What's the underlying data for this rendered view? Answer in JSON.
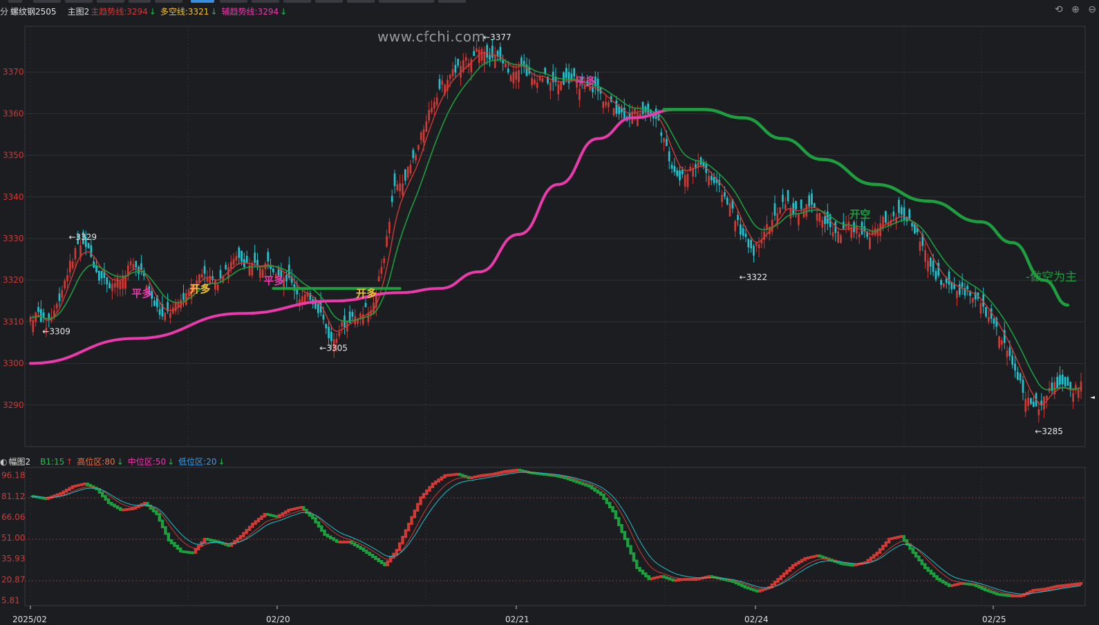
{
  "header": {
    "prefix": "分",
    "symbol": "螺纹钢2505",
    "chart_name": "主图2",
    "main_trend": "主趋势线:3294",
    "long_short": "多空线:3321",
    "aux_trend": "辅趋势线:3294",
    "arrow_down": "↓"
  },
  "subheader": {
    "prefix": "◐",
    "name": "幅图2",
    "b1": "B1:15",
    "b1_arrow": "↑",
    "high": "高位区:80",
    "mid": "中位区:50",
    "low": "低位区:20",
    "arrow_down": "↓"
  },
  "watermark": "www.cfchi.com",
  "toolbar": {
    "undo_icon": "⟲",
    "zoom_in_icon": "⊕",
    "zoom_out_icon": "⊖"
  },
  "colors": {
    "background": "#1c1d21",
    "up": "#d23a36",
    "down": "#1fc4cf",
    "main_trend": "#ea3aab",
    "long_short": "#1e9e3e",
    "red_line": "#d23a36",
    "grid": "#2e3036"
  },
  "chart_data": [
    {
      "type": "candlestick",
      "title": "螺纹钢2505",
      "y_ticks": [
        3370,
        3360,
        3350,
        3340,
        3330,
        3320,
        3310,
        3300,
        3290
      ],
      "ylim": [
        3280,
        3381
      ],
      "x_labels": [
        "2025/02",
        "02/20",
        "02/21",
        "02/24",
        "02/25"
      ],
      "anchors": [
        [
          0,
          3311
        ],
        [
          3,
          3312
        ],
        [
          6,
          3309
        ],
        [
          10,
          3314
        ],
        [
          14,
          3322
        ],
        [
          18,
          3329
        ],
        [
          22,
          3327
        ],
        [
          26,
          3321
        ],
        [
          30,
          3319
        ],
        [
          34,
          3320
        ],
        [
          38,
          3324
        ],
        [
          42,
          3322
        ],
        [
          46,
          3315
        ],
        [
          50,
          3311
        ],
        [
          54,
          3313
        ],
        [
          58,
          3316
        ],
        [
          62,
          3320
        ],
        [
          66,
          3322
        ],
        [
          70,
          3319
        ],
        [
          74,
          3323
        ],
        [
          78,
          3325
        ],
        [
          82,
          3324
        ],
        [
          86,
          3323
        ],
        [
          90,
          3324
        ],
        [
          94,
          3322
        ],
        [
          98,
          3320
        ],
        [
          102,
          3316
        ],
        [
          106,
          3316
        ],
        [
          110,
          3312
        ],
        [
          114,
          3305
        ],
        [
          118,
          3309
        ],
        [
          122,
          3311
        ],
        [
          126,
          3312
        ],
        [
          130,
          3314
        ],
        [
          134,
          3326
        ],
        [
          138,
          3342
        ],
        [
          142,
          3345
        ],
        [
          146,
          3350
        ],
        [
          150,
          3359
        ],
        [
          154,
          3365
        ],
        [
          158,
          3369
        ],
        [
          162,
          3371
        ],
        [
          166,
          3373
        ],
        [
          170,
          3376
        ],
        [
          174,
          3374
        ],
        [
          178,
          3373
        ],
        [
          182,
          3370
        ],
        [
          186,
          3372
        ],
        [
          190,
          3368
        ],
        [
          194,
          3369
        ],
        [
          198,
          3367
        ],
        [
          202,
          3368
        ],
        [
          206,
          3368
        ],
        [
          210,
          3366
        ],
        [
          214,
          3366
        ],
        [
          218,
          3363
        ],
        [
          222,
          3361
        ],
        [
          226,
          3359
        ],
        [
          230,
          3361
        ],
        [
          234,
          3360
        ],
        [
          238,
          3358
        ],
        [
          242,
          3349
        ],
        [
          246,
          3344
        ],
        [
          250,
          3347
        ],
        [
          254,
          3348
        ],
        [
          258,
          3344
        ],
        [
          262,
          3341
        ],
        [
          266,
          3337
        ],
        [
          270,
          3330
        ],
        [
          274,
          3327
        ],
        [
          278,
          3332
        ],
        [
          282,
          3335
        ],
        [
          286,
          3339
        ],
        [
          290,
          3336
        ],
        [
          294,
          3338
        ],
        [
          298,
          3337
        ],
        [
          302,
          3333
        ],
        [
          306,
          3331
        ],
        [
          310,
          3333
        ],
        [
          314,
          3332
        ],
        [
          318,
          3330
        ],
        [
          322,
          3334
        ],
        [
          326,
          3335
        ],
        [
          330,
          3336
        ],
        [
          334,
          3333
        ],
        [
          338,
          3328
        ],
        [
          342,
          3322
        ],
        [
          346,
          3319
        ],
        [
          350,
          3318
        ],
        [
          354,
          3317
        ],
        [
          358,
          3316
        ],
        [
          362,
          3312
        ],
        [
          366,
          3308
        ],
        [
          370,
          3303
        ],
        [
          374,
          3297
        ],
        [
          378,
          3291
        ],
        [
          382,
          3288
        ],
        [
          386,
          3294
        ],
        [
          390,
          3295
        ],
        [
          394,
          3293
        ],
        [
          398,
          3295
        ]
      ],
      "n_bars": 399,
      "series": [
        {
          "name": "主趋势线",
          "value": 3294
        },
        {
          "name": "多空线",
          "value": 3321
        },
        {
          "name": "辅趋势线",
          "value": 3294
        }
      ],
      "main_trend_curve": [
        [
          0,
          3300
        ],
        [
          40,
          3306
        ],
        [
          80,
          3312
        ],
        [
          115,
          3315
        ],
        [
          140,
          3317
        ],
        [
          155,
          3318
        ],
        [
          170,
          3322
        ],
        [
          185,
          3331
        ],
        [
          200,
          3343
        ],
        [
          215,
          3354
        ],
        [
          228,
          3359
        ],
        [
          245,
          3361
        ]
      ],
      "long_short_curve": [
        [
          240,
          3361
        ],
        [
          255,
          3361
        ],
        [
          270,
          3359
        ],
        [
          285,
          3354
        ],
        [
          300,
          3349
        ],
        [
          320,
          3343
        ],
        [
          340,
          3339
        ],
        [
          360,
          3334
        ],
        [
          372,
          3329
        ],
        [
          384,
          3320
        ],
        [
          393,
          3314
        ]
      ],
      "long_short_left": [
        [
          92,
          3318
        ],
        [
          100,
          3318
        ],
        [
          115,
          3318
        ],
        [
          128,
          3318
        ],
        [
          140,
          3318
        ]
      ],
      "extremes": [
        {
          "label": "←3377",
          "x": 171,
          "y": 3377
        },
        {
          "label": "←3329",
          "x": 14,
          "y": 3329
        },
        {
          "label": "←3309",
          "x": 4,
          "y": 3309
        },
        {
          "label": "←3305",
          "x": 109,
          "y": 3305
        },
        {
          "label": "←3322",
          "x": 268,
          "y": 3322
        },
        {
          "label": "←3285",
          "x": 380,
          "y": 3285
        }
      ],
      "signals": [
        {
          "text": "平多",
          "x": 42,
          "y": 3317,
          "color": "#ea3aab"
        },
        {
          "text": "开多",
          "x": 64,
          "y": 3318,
          "color": "#f1c232"
        },
        {
          "text": "平多",
          "x": 92,
          "y": 3320,
          "color": "#ea3aab"
        },
        {
          "text": "开多",
          "x": 127,
          "y": 3317,
          "color": "#f1c232"
        },
        {
          "text": "平多",
          "x": 210,
          "y": 3368,
          "color": "#ea3aab"
        },
        {
          "text": "开空",
          "x": 314,
          "y": 3336,
          "color": "#1e9e3e"
        }
      ],
      "annotation": "-做空为主"
    },
    {
      "type": "line",
      "title": "幅图2",
      "y_ticks": [
        96.18,
        81.12,
        66.06,
        51.0,
        35.93,
        20.87,
        5.81
      ],
      "ylim": [
        2,
        100
      ],
      "ref_lines": [
        80,
        50,
        20
      ],
      "stairs": [
        [
          0,
          81
        ],
        [
          5,
          79
        ],
        [
          10,
          83
        ],
        [
          14,
          88
        ],
        [
          18,
          90
        ],
        [
          22,
          86
        ],
        [
          26,
          76
        ],
        [
          30,
          71
        ],
        [
          34,
          72
        ],
        [
          38,
          76
        ],
        [
          42,
          68
        ],
        [
          46,
          49
        ],
        [
          50,
          41
        ],
        [
          54,
          40
        ],
        [
          58,
          50
        ],
        [
          62,
          48
        ],
        [
          66,
          45
        ],
        [
          70,
          52
        ],
        [
          74,
          61
        ],
        [
          78,
          68
        ],
        [
          82,
          66
        ],
        [
          86,
          71
        ],
        [
          90,
          73
        ],
        [
          94,
          65
        ],
        [
          98,
          53
        ],
        [
          102,
          48
        ],
        [
          106,
          48
        ],
        [
          110,
          43
        ],
        [
          114,
          37
        ],
        [
          118,
          31
        ],
        [
          122,
          42
        ],
        [
          126,
          61
        ],
        [
          130,
          80
        ],
        [
          134,
          90
        ],
        [
          138,
          96
        ],
        [
          142,
          97
        ],
        [
          146,
          94
        ],
        [
          150,
          96
        ],
        [
          154,
          97
        ],
        [
          158,
          99
        ],
        [
          162,
          100
        ],
        [
          166,
          98
        ],
        [
          170,
          97
        ],
        [
          174,
          96
        ],
        [
          178,
          94
        ],
        [
          182,
          91
        ],
        [
          186,
          88
        ],
        [
          190,
          82
        ],
        [
          194,
          70
        ],
        [
          198,
          50
        ],
        [
          202,
          29
        ],
        [
          206,
          21
        ],
        [
          210,
          23
        ],
        [
          214,
          20
        ],
        [
          218,
          21
        ],
        [
          222,
          21
        ],
        [
          226,
          23
        ],
        [
          230,
          21
        ],
        [
          234,
          19
        ],
        [
          238,
          15
        ],
        [
          242,
          12
        ],
        [
          246,
          15
        ],
        [
          250,
          23
        ],
        [
          254,
          31
        ],
        [
          258,
          36
        ],
        [
          262,
          38
        ],
        [
          266,
          35
        ],
        [
          270,
          32
        ],
        [
          274,
          31
        ],
        [
          278,
          33
        ],
        [
          282,
          40
        ],
        [
          286,
          50
        ],
        [
          290,
          52
        ],
        [
          294,
          40
        ],
        [
          298,
          29
        ],
        [
          302,
          21
        ],
        [
          306,
          16
        ],
        [
          310,
          18
        ],
        [
          314,
          17
        ],
        [
          318,
          13
        ],
        [
          322,
          10
        ],
        [
          326,
          9
        ],
        [
          330,
          9
        ],
        [
          334,
          13
        ],
        [
          338,
          14
        ],
        [
          342,
          16
        ],
        [
          346,
          17
        ],
        [
          350,
          18
        ]
      ],
      "n_points": 351
    }
  ]
}
